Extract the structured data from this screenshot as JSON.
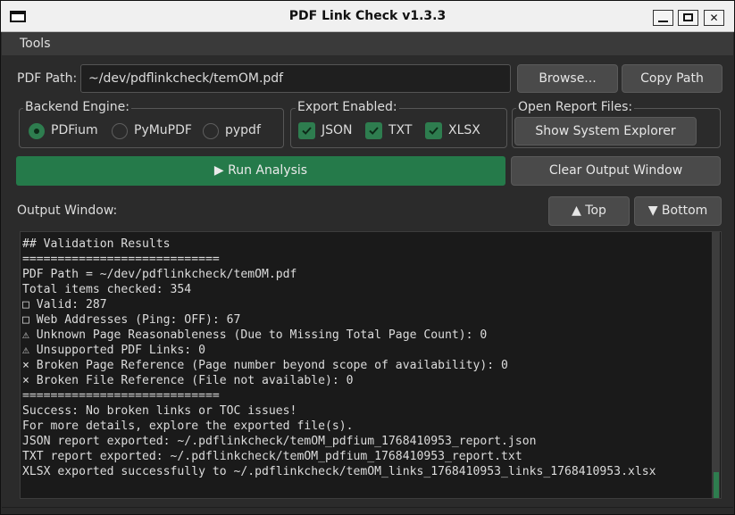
{
  "window": {
    "title": "PDF Link Check v1.3.3"
  },
  "menu": {
    "tools": "Tools"
  },
  "path": {
    "label": "PDF Path:",
    "value": "~/dev/pdflinkcheck/temOM.pdf",
    "browse": "Browse...",
    "copy": "Copy Path"
  },
  "backend": {
    "title": "Backend Engine:",
    "options": [
      "PDFium",
      "PyMuPDF",
      "pypdf"
    ],
    "selected": "PDFium"
  },
  "export": {
    "title": "Export Enabled:",
    "options": [
      "JSON",
      "TXT",
      "XLSX"
    ],
    "checked": [
      true,
      true,
      true
    ]
  },
  "report": {
    "title": "Open Report Files:",
    "button": "Show System Explorer"
  },
  "actions": {
    "run": "▶ Run Analysis",
    "clear": "Clear Output Window"
  },
  "output": {
    "label": "Output Window:",
    "top": "▲ Top",
    "bottom": "▼ Bottom",
    "lines": [
      "## Validation Results",
      "============================",
      "PDF Path = ~/dev/pdflinkcheck/temOM.pdf",
      "Total items checked: 354",
      "□ Valid: 287",
      "□ Web Addresses (Ping: OFF): 67",
      "⚠ Unknown Page Reasonableness (Due to Missing Total Page Count): 0",
      "⚠ Unsupported PDF Links: 0",
      "× Broken Page Reference (Page number beyond scope of availability): 0",
      "× Broken File Reference (File not available): 0",
      "============================",
      "Success: No broken links or TOC issues!",
      "For more details, explore the exported file(s).",
      "JSON report exported: ~/.pdflinkcheck/temOM_pdfium_1768410953_report.json",
      "TXT report exported: ~/.pdflinkcheck/temOM_pdfium_1768410953_report.txt",
      "XLSX exported successfully to ~/.pdflinkcheck/temOM_links_1768410953_links_1768410953.xlsx"
    ]
  },
  "colors": {
    "accent": "#2e7d4f",
    "run": "#257a4a",
    "background": "#2b2b2b"
  }
}
